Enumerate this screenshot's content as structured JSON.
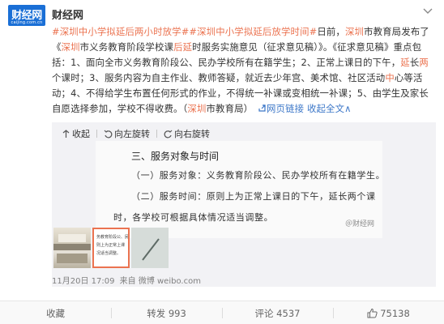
{
  "author": {
    "name": "财经网",
    "logo_text": "财经网",
    "logo_sub": "caijing.com.cn"
  },
  "post": {
    "tag": "#深圳中小学拟延后两小时放学#",
    "tag2": "#深圳中小学拟延后放学时间#",
    "s1": "日前，",
    "link1": "深圳",
    "s2": "市教育局发布了《",
    "link2": "深圳",
    "s3": "市义务教育阶段学校课",
    "link3": "后延",
    "s4": "时服务实施意见（征求意见稿）》。《征求意见稿》重点包括：1、面向全市义务教育阶段公、民办学校所有在籍学生；2、正常上课日的下午，",
    "link4": "延",
    "s5": "长",
    "link5": "两",
    "s6": "个课时；3、服务内容为自主作业、教师答疑，就近去少年宫、美术馆、社区活动",
    "link6": "中",
    "s7": "心等活动；4、不得给学生布置任何形式的作业，不得统一补课或变相统一补课；5、由学生及家长自愿选择参加，学校不得收费。（",
    "source_link": "深圳",
    "s8": "市教育局）",
    "web_link": "网页链接",
    "collapse": "收起全文",
    "collapse_arrow": "∧"
  },
  "media": {
    "tools": {
      "collapse": "收起",
      "rotate_left": "向左旋转",
      "rotate_right": "向右旋转"
    },
    "image": {
      "heading": "三、服务对象与时间",
      "line1": "（一）服务对象：义务教育阶段公、民办学校所有在籍学生。",
      "line2": "（二）服务时间：原则上为正常上课日的下午，延长两个课",
      "line3": "时，各学校可根据具体情况适当调整。",
      "watermark": "＠财经网"
    },
    "thumbs": {
      "t2_line1": "务教育阶段公、民",
      "t2_line2": "则上为正常上课",
      "t2_line3": "况适当调整。"
    }
  },
  "meta": {
    "date": "11月20日 17:09",
    "source": "来自 微博 weibo.com"
  },
  "footer": {
    "collect": "收藏",
    "repost": "转发 993",
    "comment": "评论 4537",
    "like": "75138"
  },
  "colors": {
    "link_orange": "#eb7350",
    "link_blue": "#3c77c8",
    "brand_blue": "#1a6fd6"
  }
}
